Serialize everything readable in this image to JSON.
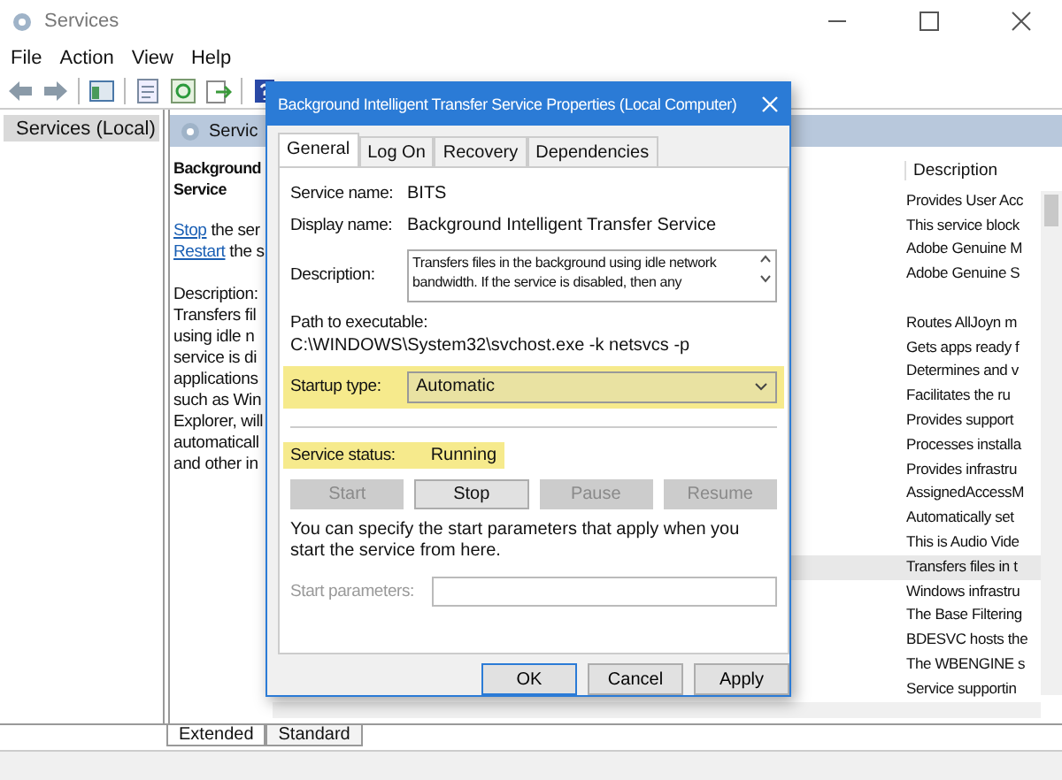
{
  "window": {
    "title": "Services"
  },
  "menu": [
    {
      "label": "File"
    },
    {
      "label": "Action"
    },
    {
      "label": "View"
    },
    {
      "label": "Help"
    }
  ],
  "tree": [
    {
      "label": "Services (Local)",
      "selected": true
    }
  ],
  "pane_header": "Servic",
  "detail": {
    "heading_lines": [
      "Background",
      "Service"
    ],
    "actions": [
      {
        "link": "Stop",
        "rest": " the ser"
      },
      {
        "link": "Restart",
        "rest": " the s"
      }
    ],
    "description_label": "Description:",
    "description_lines": [
      "Transfers fil",
      "using idle n",
      "service is di",
      "applications",
      "such as Win",
      "Explorer, will",
      "automaticall",
      "and other in"
    ]
  },
  "description_column": {
    "heading": "Description",
    "rows": [
      {
        "text": "Provides User Acc",
        "selected": false,
        "spaced": false
      },
      {
        "text": "This service block",
        "selected": false,
        "spaced": false
      },
      {
        "text": "Adobe Genuine M",
        "selected": false,
        "spaced": false
      },
      {
        "text": "Adobe Genuine S",
        "selected": false,
        "spaced": false
      },
      {
        "text": "Routes AllJoyn m",
        "selected": false,
        "spaced": true
      },
      {
        "text": "Gets apps ready f",
        "selected": false,
        "spaced": false
      },
      {
        "text": "Determines and v",
        "selected": false,
        "spaced": false
      },
      {
        "text": "Facilitates the ru",
        "selected": false,
        "spaced": false
      },
      {
        "text": "Provides support",
        "selected": false,
        "spaced": false
      },
      {
        "text": "Processes installa",
        "selected": false,
        "spaced": false
      },
      {
        "text": "Provides infrastru",
        "selected": false,
        "spaced": false
      },
      {
        "text": "AssignedAccessM",
        "selected": false,
        "spaced": false
      },
      {
        "text": "Automatically set",
        "selected": false,
        "spaced": false
      },
      {
        "text": "This is Audio Vide",
        "selected": false,
        "spaced": false
      },
      {
        "text": "Transfers files in t",
        "selected": true,
        "spaced": false
      },
      {
        "text": "Windows infrastru",
        "selected": false,
        "spaced": false
      },
      {
        "text": "The Base Filtering",
        "selected": false,
        "spaced": false
      },
      {
        "text": "BDESVC hosts the",
        "selected": false,
        "spaced": false
      },
      {
        "text": "The WBENGINE s",
        "selected": false,
        "spaced": false
      },
      {
        "text": "Service supportin",
        "selected": false,
        "spaced": false
      }
    ]
  },
  "bottom_tabs": [
    {
      "label": "Extended",
      "selected": true
    },
    {
      "label": "Standard",
      "selected": false
    }
  ],
  "dialog": {
    "title": "Background Intelligent Transfer Service Properties (Local Computer)",
    "tabs": [
      {
        "label": "General",
        "selected": true
      },
      {
        "label": "Log On",
        "selected": false
      },
      {
        "label": "Recovery",
        "selected": false
      },
      {
        "label": "Dependencies",
        "selected": false
      }
    ],
    "service_name": {
      "label": "Service name:",
      "value": "BITS"
    },
    "display_name": {
      "label": "Display name:",
      "value": "Background Intelligent Transfer Service"
    },
    "description": {
      "label": "Description:",
      "lines": [
        "Transfers files in the background using idle network",
        "bandwidth. If the service is disabled, then any"
      ]
    },
    "path": {
      "label": "Path to executable:",
      "value": "C:\\WINDOWS\\System32\\svchost.exe -k netsvcs -p"
    },
    "startup_type": {
      "label": "Startup type:",
      "value": "Automatic",
      "highlighted": true
    },
    "service_status": {
      "label": "Service status:",
      "value": "Running",
      "highlighted": true
    },
    "control_buttons": [
      {
        "label": "Start",
        "disabled": true
      },
      {
        "label": "Stop",
        "disabled": false
      },
      {
        "label": "Pause",
        "disabled": true
      },
      {
        "label": "Resume",
        "disabled": true
      }
    ],
    "hint": "You can specify the start parameters that apply when you start the service from here.",
    "start_parameters": {
      "label": "Start parameters:",
      "disabled": true
    },
    "footer_buttons": [
      {
        "label": "OK",
        "default": true
      },
      {
        "label": "Cancel",
        "default": false
      },
      {
        "label": "Apply",
        "default": false
      }
    ]
  }
}
